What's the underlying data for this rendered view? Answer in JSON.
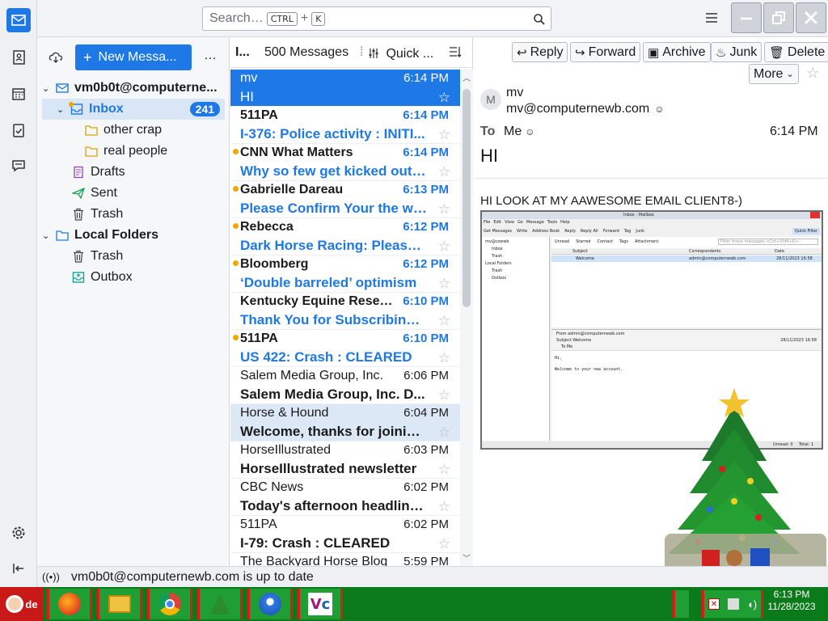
{
  "spaces": {
    "items": [
      {
        "name": "mail-space",
        "active": true
      },
      {
        "name": "address-book-space",
        "active": false
      },
      {
        "name": "calendar-space",
        "active": false
      },
      {
        "name": "tasks-space",
        "active": false
      },
      {
        "name": "chat-space",
        "active": false
      }
    ]
  },
  "search": {
    "placeholder": "Search…",
    "shortcut_key1": "CTRL",
    "shortcut_plus": "+",
    "shortcut_key2": "K"
  },
  "folder_pane": {
    "new_message_label": "New Messa...",
    "more_label": "…",
    "account": "vm0b0t@computerne...",
    "folders": [
      {
        "label": "Inbox",
        "count": "241"
      },
      {
        "label": "other crap"
      },
      {
        "label": "real people"
      },
      {
        "label": "Drafts"
      },
      {
        "label": "Sent"
      },
      {
        "label": "Trash"
      }
    ],
    "local_folders": "Local Folders",
    "local_items": [
      {
        "label": "Trash"
      },
      {
        "label": "Outbox"
      }
    ]
  },
  "message_list": {
    "col_indicator": "I...",
    "count_label": "500 Messages",
    "quick_filter_label": "Quick ...",
    "messages": [
      {
        "from": "mv",
        "time": "6:14 PM",
        "subject": "HI",
        "state": "selected",
        "dot": false
      },
      {
        "from": "511PA",
        "time": "6:14 PM",
        "subject": "I-376: Police activity : INITI...",
        "state": "unread",
        "dot": false
      },
      {
        "from": "CNN What Matters",
        "time": "6:14 PM",
        "subject": "Why so few get kicked out o...",
        "state": "unread",
        "dot": true
      },
      {
        "from": "Gabrielle Dareau",
        "time": "6:13 PM",
        "subject": "Please Confirm Your the wh...",
        "state": "unread",
        "dot": true
      },
      {
        "from": "Rebecca",
        "time": "6:12 PM",
        "subject": "Dark Horse Racing: Please ...",
        "state": "unread",
        "dot": true
      },
      {
        "from": "Bloomberg",
        "time": "6:12 PM",
        "subject": "‘Double barreled’ optimism",
        "state": "unread",
        "dot": true
      },
      {
        "from": "Kentucky Equine Resear...",
        "time": "6:10 PM",
        "subject": "Thank You for Subscribing t...",
        "state": "unread",
        "dot": false
      },
      {
        "from": "511PA",
        "time": "6:10 PM",
        "subject": "US 422: Crash : CLEARED",
        "state": "unread",
        "dot": true
      },
      {
        "from": "Salem Media Group, Inc.",
        "time": "6:06 PM",
        "subject": "Salem Media Group, Inc. D...",
        "state": "read",
        "dot": false
      },
      {
        "from": "Horse & Hound",
        "time": "6:04 PM",
        "subject": "Welcome, thanks for joining...",
        "state": "hover",
        "dot": false
      },
      {
        "from": "HorseIllustrated",
        "time": "6:03 PM",
        "subject": "HorseIllustrated newsletter",
        "state": "read",
        "dot": false
      },
      {
        "from": "CBC News",
        "time": "6:02 PM",
        "subject": "Today's afternoon headline...",
        "state": "read",
        "dot": false
      },
      {
        "from": "511PA",
        "time": "6:02 PM",
        "subject": "I-79: Crash : CLEARED",
        "state": "read",
        "dot": false
      },
      {
        "from": "The Backyard Horse Blog",
        "time": "5:59 PM",
        "subject": "",
        "state": "read",
        "dot": false
      }
    ]
  },
  "reader": {
    "actions": {
      "reply": "Reply",
      "forward": "Forward",
      "archive": "Archive",
      "junk": "Junk",
      "delete": "Delete",
      "more": "More"
    },
    "avatar_letter": "M",
    "from_name": "mv",
    "from_email": "mv@computernewb.com",
    "to_label": "To",
    "to_value": "Me",
    "time": "6:14 PM",
    "subject": "HI",
    "body": "HI LOOK AT MY AAWESOME EMAIL CLIENT8-)"
  },
  "embedded_screenshot": {
    "title": "Inbox - Mailbox",
    "menu": [
      "File",
      "Edit",
      "View",
      "Go",
      "Message",
      "Tools",
      "Help"
    ],
    "toolbar": [
      "Get Messages",
      "Write",
      "Address Book",
      "Reply",
      "Reply All",
      "Forward",
      "Tag",
      "Junk"
    ],
    "quick_filter": "Quick Filter",
    "folders": [
      "mv@cswwb",
      "Inbox",
      "Trash",
      "Local Folders",
      "Trash",
      "Outbox"
    ],
    "filters": [
      "Unread",
      "Starred",
      "Contact",
      "Tags",
      "Attachment"
    ],
    "filter_placeholder": "Filter these messages <Ctrl+Shift+K>",
    "columns": [
      "Subject",
      "Correspondents",
      "Date"
    ],
    "row": {
      "subject": "Welcome",
      "from": "admin@computernewb.com",
      "date": "28/11/2023 16:58"
    },
    "header_from": "From admin@computernewb.com",
    "header_subject": "Subject Welcome",
    "header_to": "To Me",
    "header_date": "28/11/2023 16:58",
    "body_line1": "Hi,",
    "body_line2": "Welcome to your new account.",
    "status_unread": "Unread: 0",
    "status_total": "Total: 1"
  },
  "status_bar": {
    "text": "vm0b0t@computernewb.com is up to date"
  },
  "taskbar": {
    "start_label": "de",
    "apps": [
      "firefox",
      "file-manager",
      "chrome",
      "christmas-tree",
      "thunderbird",
      "vc"
    ],
    "clock_time": "6:13 PM",
    "clock_date": "11/28/2023"
  },
  "colors": {
    "accent": "#1e78e6",
    "taskbar": "#0a7a1a",
    "unread_dot": "#f0a800"
  }
}
